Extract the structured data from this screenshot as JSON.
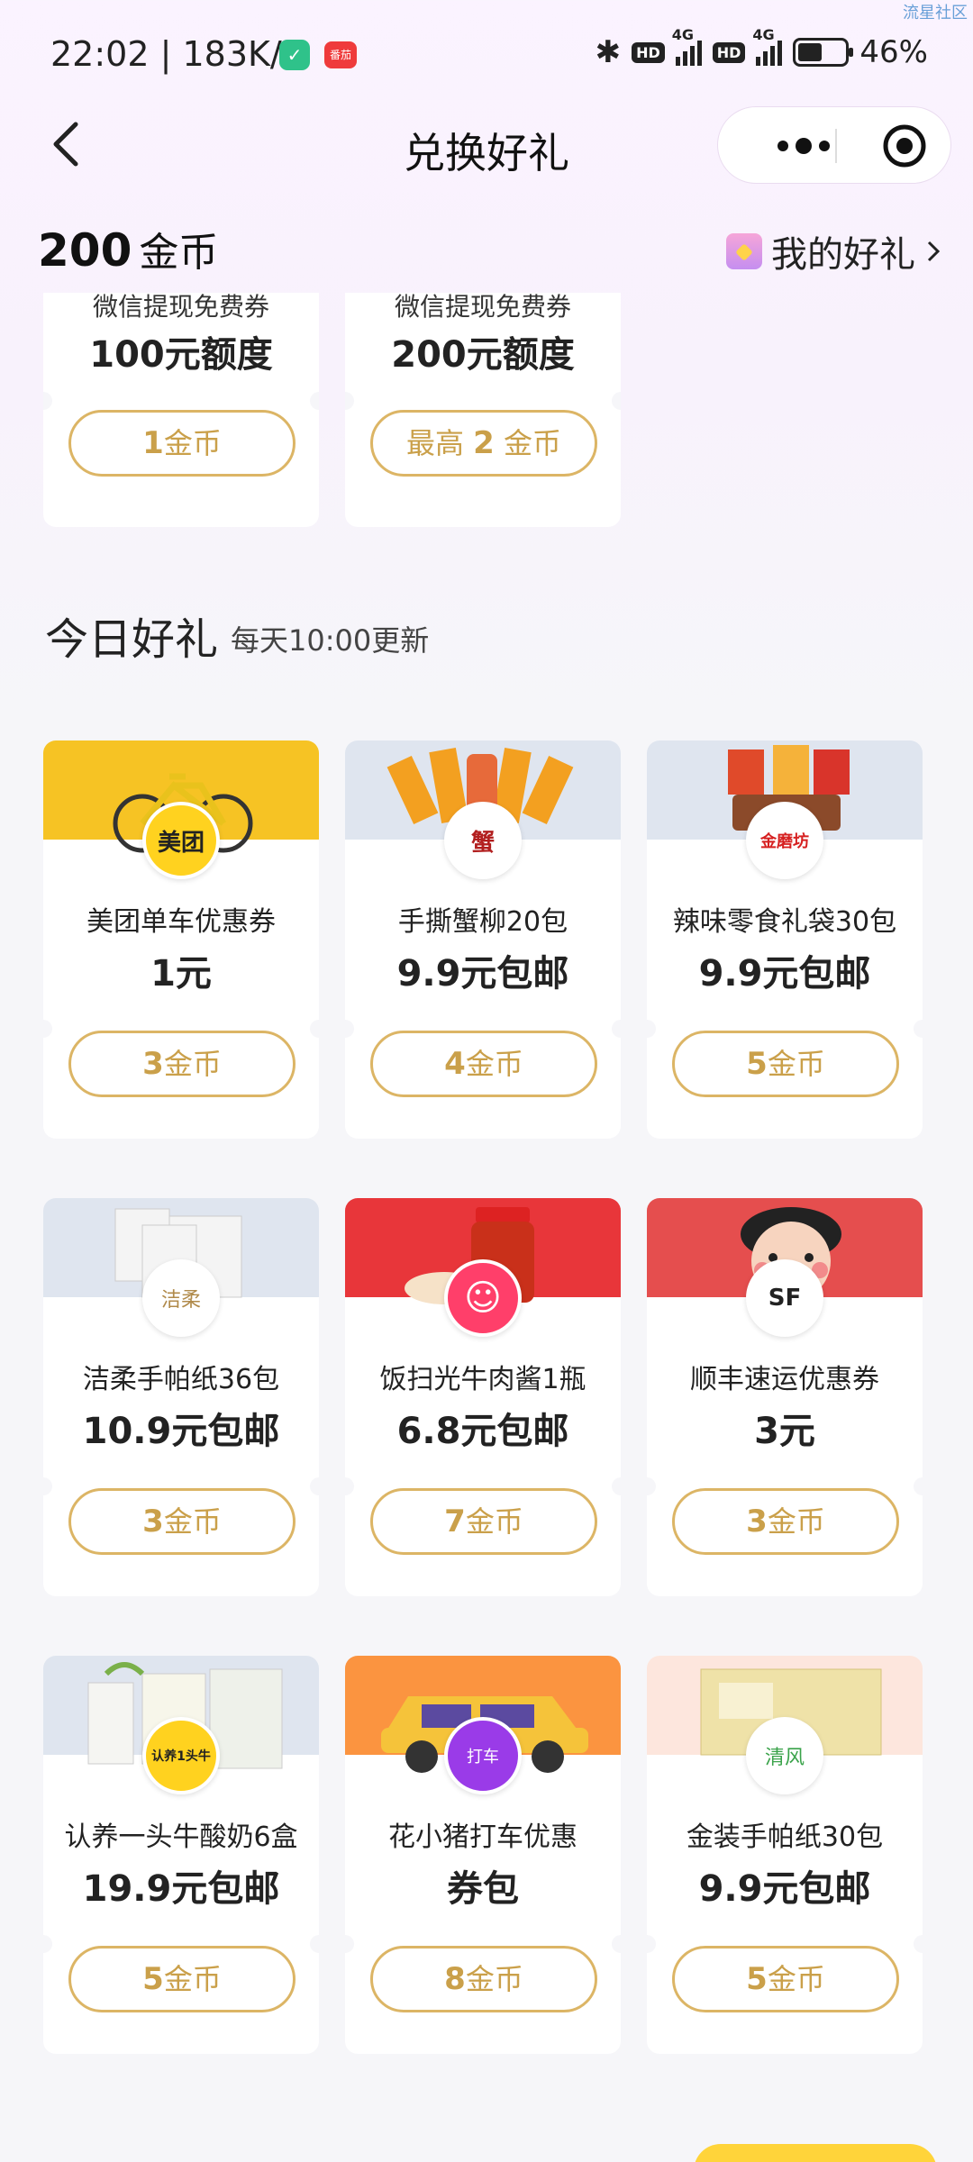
{
  "watermark": "流星社区",
  "status": {
    "time_speed": "22:02 | 183K/s",
    "app1": "✓",
    "app2": "番茄",
    "hd": "HD",
    "net": "4G",
    "battery": "46%"
  },
  "nav": {
    "title": "兑换好礼"
  },
  "balance": {
    "amount": "200",
    "unit": "金币",
    "my_gifts": "我的好礼"
  },
  "top_cards": [
    {
      "sub": "微信提现免费券",
      "amount": "100元额度",
      "btn_prefix": "",
      "btn_num": "1",
      "btn_unit": "金币"
    },
    {
      "sub": "微信提现免费券",
      "amount": "200元额度",
      "btn_prefix": "最高 ",
      "btn_num": "2",
      "btn_unit": " 金币"
    }
  ],
  "section": {
    "title": "今日好礼",
    "subtitle": "每天10:00更新"
  },
  "gifts": [
    {
      "name": "美团单车优惠券",
      "price": "1元",
      "coins": "3",
      "unit": "金币",
      "logo": "美团",
      "banner": "#f6c324"
    },
    {
      "name": "手撕蟹柳20包",
      "price": "9.9元包邮",
      "coins": "4",
      "unit": "金币",
      "logo": "蟹",
      "banner": "#dfe5ef"
    },
    {
      "name": "辣味零食礼袋30包",
      "price": "9.9元包邮",
      "coins": "5",
      "unit": "金币",
      "logo": "金磨坊",
      "banner": "#dfe5ef"
    },
    {
      "name": "洁柔手帕纸36包",
      "price": "10.9元包邮",
      "coins": "3",
      "unit": "金币",
      "logo": "洁柔",
      "banner": "#dfe5ef"
    },
    {
      "name": "饭扫光牛肉酱1瓶",
      "price": "6.8元包邮",
      "coins": "7",
      "unit": "金币",
      "logo": "☺",
      "banner": "#e8363a"
    },
    {
      "name": "顺丰速运优惠券",
      "price": "3元",
      "coins": "3",
      "unit": "金币",
      "logo": "SF",
      "banner": "#e54e4e"
    },
    {
      "name": "认养一头牛酸奶6盒",
      "price": "19.9元包邮",
      "coins": "5",
      "unit": "金币",
      "logo": "认养1头牛",
      "banner": "#dfe5ef"
    },
    {
      "name": "花小猪打车优惠",
      "price": "券包",
      "coins": "8",
      "unit": "金币",
      "logo": "打车",
      "banner": "#fb9440"
    },
    {
      "name": "金装手帕纸30包",
      "price": "9.9元包邮",
      "coins": "5",
      "unit": "金币",
      "logo": "清风",
      "banner": "#fde6dd"
    }
  ]
}
